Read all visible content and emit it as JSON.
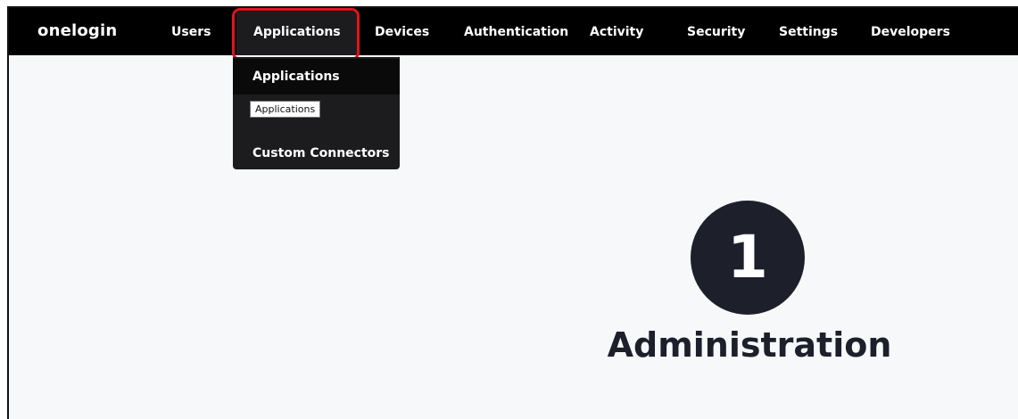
{
  "brand": {
    "logo_text": "onelogin"
  },
  "nav": {
    "items": [
      {
        "label": "Users"
      },
      {
        "label": "Applications"
      },
      {
        "label": "Devices"
      },
      {
        "label": "Authentication"
      },
      {
        "label": "Activity"
      },
      {
        "label": "Security"
      },
      {
        "label": "Settings"
      },
      {
        "label": "Developers"
      }
    ]
  },
  "dropdown": {
    "items": [
      {
        "label": "Applications"
      },
      {
        "label": "Custom Connectors"
      }
    ],
    "tooltip": "Applications"
  },
  "main": {
    "badge_glyph": "1",
    "title": "Administration"
  },
  "colors": {
    "topbar": "#000000",
    "dropdown": "#1c1c1e",
    "highlight": "#e0141e",
    "badge": "#1d1f2b",
    "background": "#f7f8fa"
  }
}
